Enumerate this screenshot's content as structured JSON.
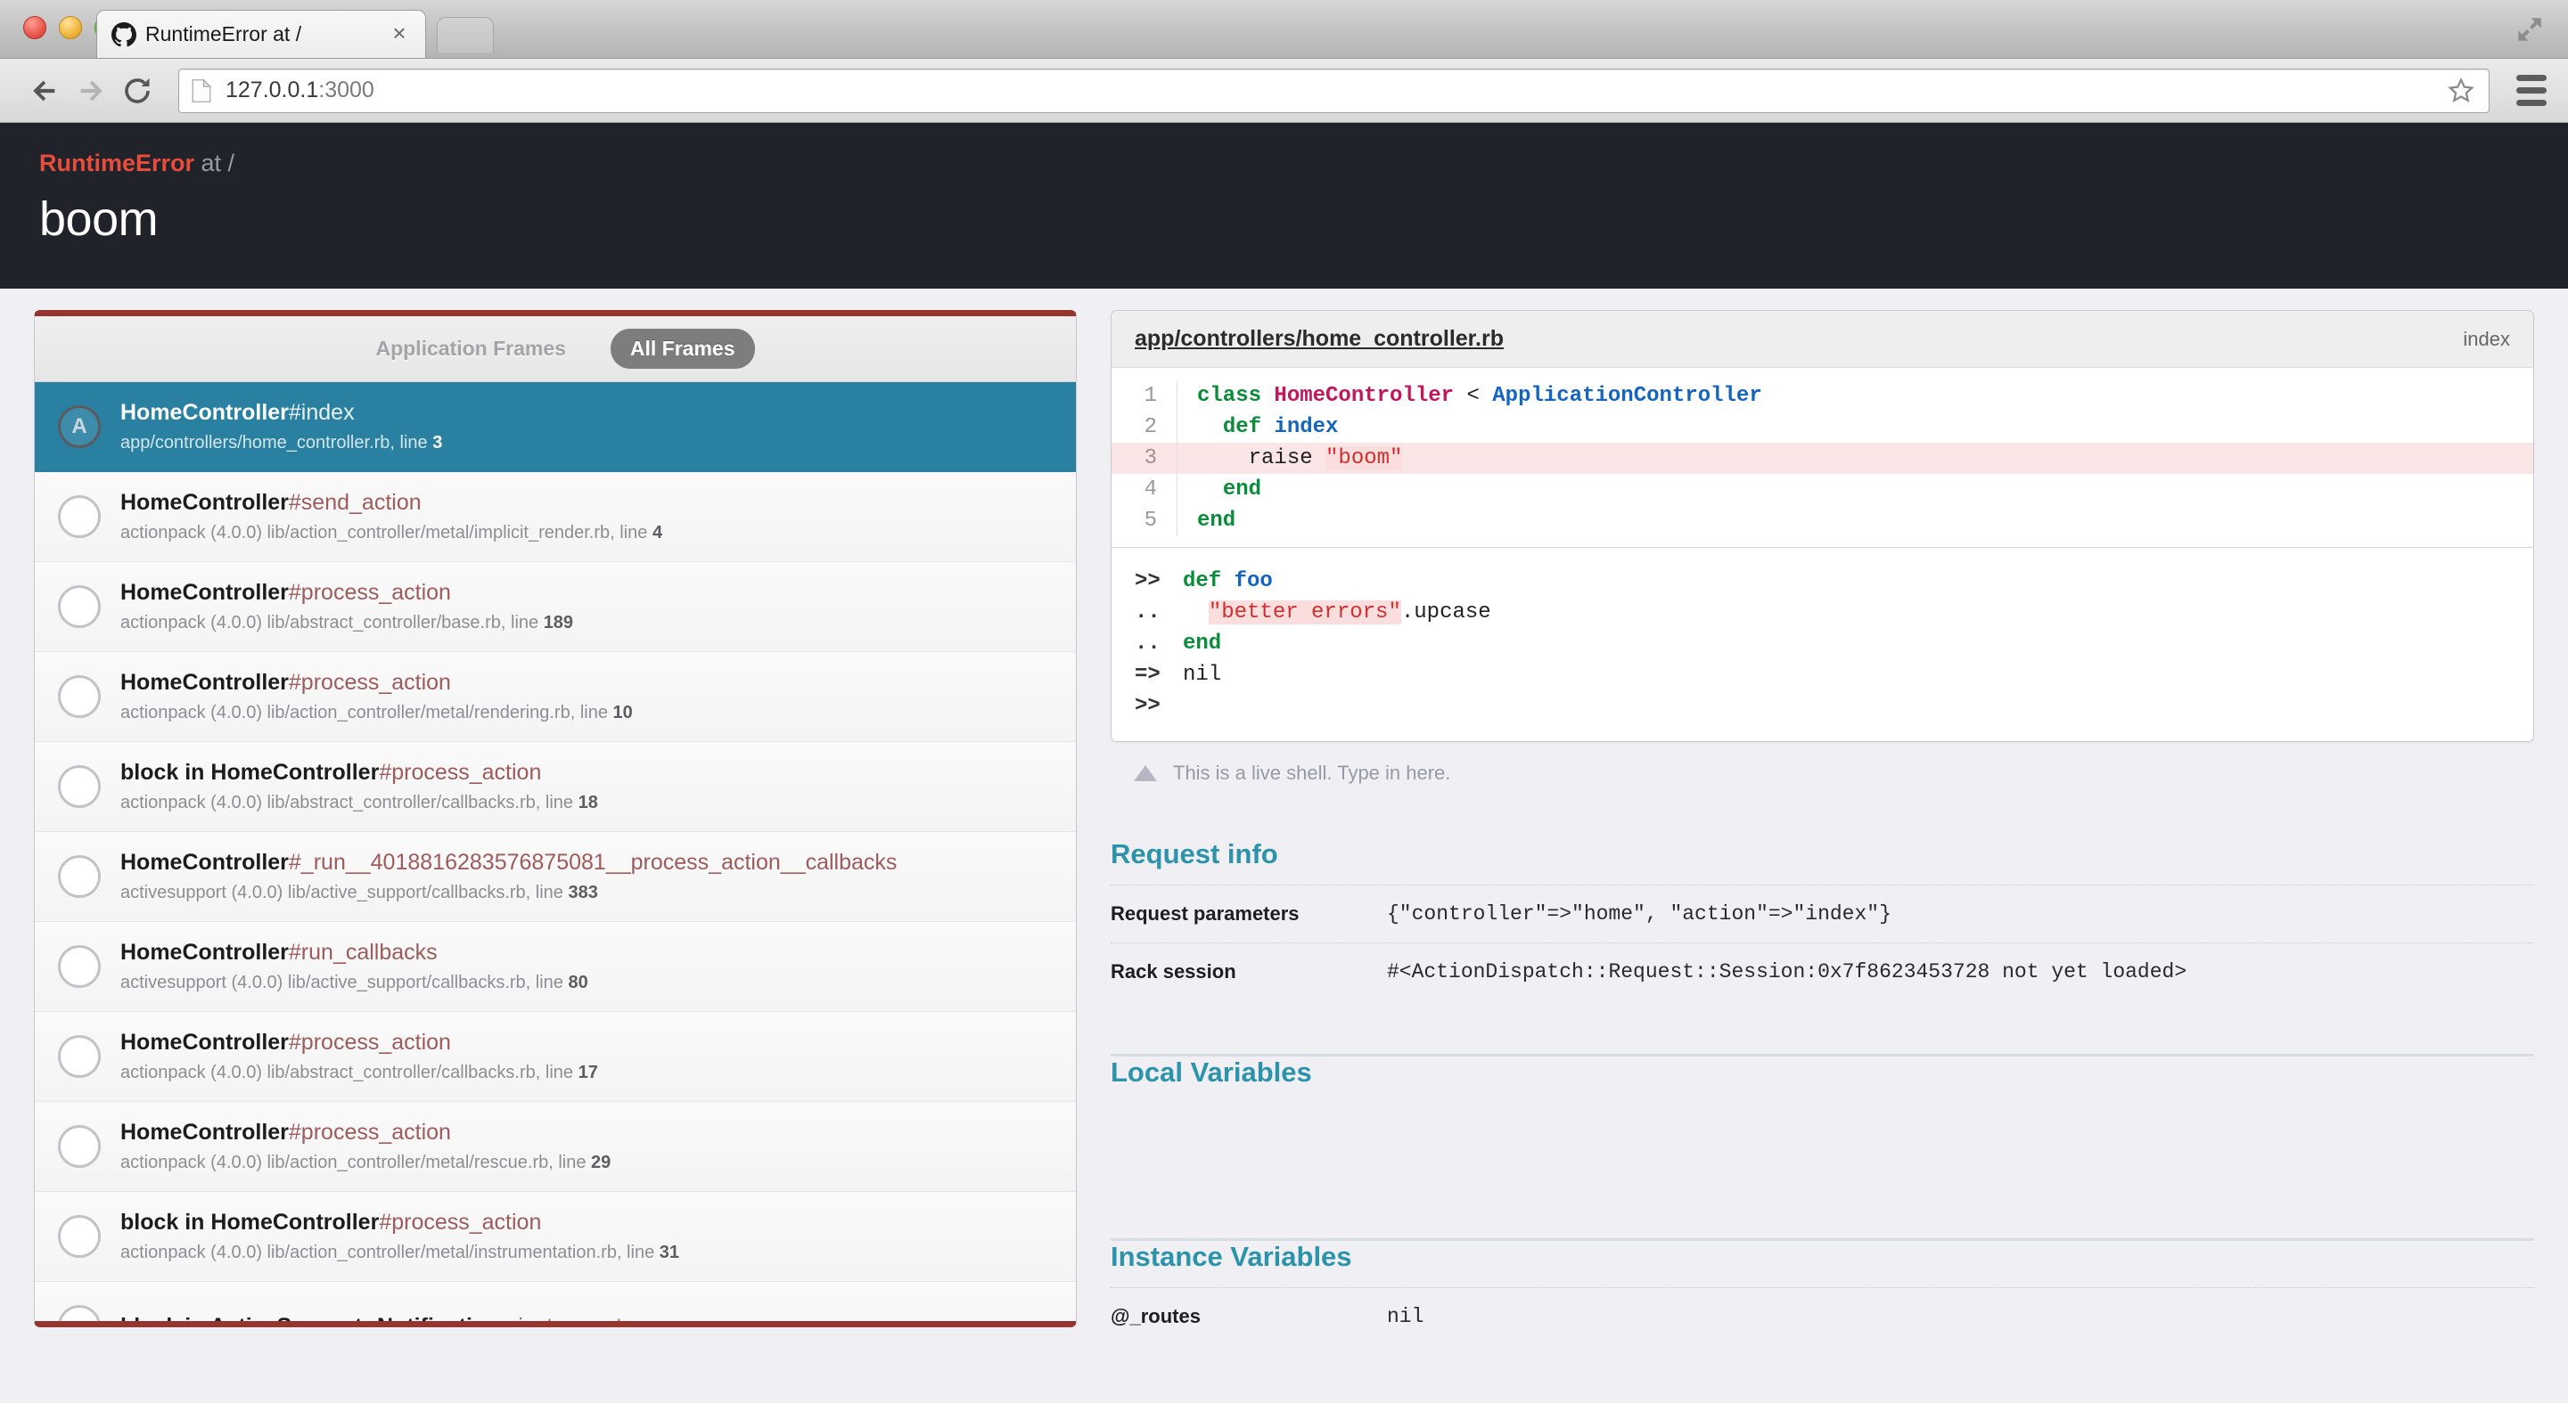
{
  "browser": {
    "tab_title": "RuntimeError at /",
    "tab_favicon": "github-octocat-icon",
    "close_icon": "close-icon",
    "new_tab_icon": "new-tab-button",
    "back_icon": "back-arrow-icon",
    "forward_icon": "forward-arrow-icon",
    "reload_icon": "reload-icon",
    "page_icon": "page-document-icon",
    "star_icon": "bookmark-star-icon",
    "menu_icon": "hamburger-menu-icon",
    "expand_icon": "fullscreen-expand-icon",
    "url_host": "127.0.0.1",
    "url_port": ":3000"
  },
  "error": {
    "exception": "RuntimeError",
    "at": " at /",
    "message": "boom"
  },
  "frames_panel": {
    "tabs": [
      {
        "label": "Application Frames",
        "active": false
      },
      {
        "label": "All Frames",
        "active": true
      }
    ],
    "frames": [
      {
        "badge": "A",
        "prefix": "",
        "cls": "HomeController",
        "meth": "#index",
        "file": "app/controllers/home_controller.rb, line ",
        "line": "3",
        "active": true
      },
      {
        "badge": "",
        "prefix": "",
        "cls": "HomeController",
        "meth": "#send_action",
        "file": "actionpack (4.0.0) lib/action_controller/metal/implicit_render.rb, line ",
        "line": "4",
        "active": false
      },
      {
        "badge": "",
        "prefix": "",
        "cls": "HomeController",
        "meth": "#process_action",
        "file": "actionpack (4.0.0) lib/abstract_controller/base.rb, line ",
        "line": "189",
        "active": false
      },
      {
        "badge": "",
        "prefix": "",
        "cls": "HomeController",
        "meth": "#process_action",
        "file": "actionpack (4.0.0) lib/action_controller/metal/rendering.rb, line ",
        "line": "10",
        "active": false
      },
      {
        "badge": "",
        "prefix": "block in ",
        "cls": "HomeController",
        "meth": "#process_action",
        "file": "actionpack (4.0.0) lib/abstract_controller/callbacks.rb, line ",
        "line": "18",
        "active": false
      },
      {
        "badge": "",
        "prefix": "",
        "cls": "HomeController",
        "meth": "#_run__4018816283576875081__process_action__callbacks",
        "file": "activesupport (4.0.0) lib/active_support/callbacks.rb, line ",
        "line": "383",
        "active": false
      },
      {
        "badge": "",
        "prefix": "",
        "cls": "HomeController",
        "meth": "#run_callbacks",
        "file": "activesupport (4.0.0) lib/active_support/callbacks.rb, line ",
        "line": "80",
        "active": false
      },
      {
        "badge": "",
        "prefix": "",
        "cls": "HomeController",
        "meth": "#process_action",
        "file": "actionpack (4.0.0) lib/abstract_controller/callbacks.rb, line ",
        "line": "17",
        "active": false
      },
      {
        "badge": "",
        "prefix": "",
        "cls": "HomeController",
        "meth": "#process_action",
        "file": "actionpack (4.0.0) lib/action_controller/metal/rescue.rb, line ",
        "line": "29",
        "active": false
      },
      {
        "badge": "",
        "prefix": "block in ",
        "cls": "HomeController",
        "meth": "#process_action",
        "file": "actionpack (4.0.0) lib/action_controller/metal/instrumentation.rb, line ",
        "line": "31",
        "active": false
      },
      {
        "badge": "",
        "prefix": "block in ",
        "cls": "ActiveSupport::Notifications",
        "meth": ".instrument",
        "file": "",
        "line": "",
        "active": false
      }
    ]
  },
  "source": {
    "file": "app/controllers/home_controller.rb",
    "method": "index",
    "lines": [
      {
        "n": "1",
        "highlight": false,
        "tokens": [
          {
            "t": "class ",
            "c": "k"
          },
          {
            "t": "HomeController",
            "c": "cn"
          },
          {
            "t": " < ",
            "c": ""
          },
          {
            "t": "ApplicationController",
            "c": "cn2"
          }
        ]
      },
      {
        "n": "2",
        "highlight": false,
        "tokens": [
          {
            "t": "  ",
            "c": ""
          },
          {
            "t": "def ",
            "c": "k"
          },
          {
            "t": "index",
            "c": "mn"
          }
        ]
      },
      {
        "n": "3",
        "highlight": true,
        "tokens": [
          {
            "t": "    raise ",
            "c": ""
          },
          {
            "t": "\"boom\"",
            "c": "sthl"
          }
        ]
      },
      {
        "n": "4",
        "highlight": false,
        "tokens": [
          {
            "t": "  ",
            "c": ""
          },
          {
            "t": "end",
            "c": "k"
          }
        ]
      },
      {
        "n": "5",
        "highlight": false,
        "tokens": [
          {
            "t": "end",
            "c": "k"
          }
        ]
      }
    ]
  },
  "repl": {
    "lines": [
      {
        "prompt": ">>",
        "tokens": [
          {
            "t": "def ",
            "c": "k"
          },
          {
            "t": "foo",
            "c": "mn"
          }
        ]
      },
      {
        "prompt": "..",
        "tokens": [
          {
            "t": "  ",
            "c": ""
          },
          {
            "t": "\"better errors\"",
            "c": "sthl"
          },
          {
            "t": ".upcase",
            "c": ""
          }
        ]
      },
      {
        "prompt": "..",
        "tokens": [
          {
            "t": "end",
            "c": "k"
          }
        ]
      },
      {
        "prompt": "=>",
        "tokens": [
          {
            "t": "nil",
            "c": ""
          }
        ]
      },
      {
        "prompt": ">>",
        "tokens": [
          {
            "t": "",
            "c": ""
          }
        ]
      }
    ],
    "hint": "This is a live shell. Type in here.",
    "hint_icon": "triangle-up-icon"
  },
  "sections": [
    {
      "title": "Request info",
      "rows": [
        {
          "key": "Request parameters",
          "value": "{\"controller\"=>\"home\", \"action\"=>\"index\"}"
        },
        {
          "key": "Rack session",
          "value": "#<ActionDispatch::Request::Session:0x7f8623453728 not yet loaded>"
        }
      ]
    },
    {
      "title": "Local Variables",
      "rows": []
    },
    {
      "title": "Instance Variables",
      "rows": [
        {
          "key": "@_routes",
          "value": "nil"
        }
      ]
    }
  ],
  "colors": {
    "header_bg": "#20232a",
    "exception_red": "#e74c3c",
    "panel_border_red": "#96352f",
    "active_frame_blue": "#2980a0",
    "section_teal": "#2c93ab",
    "highlight_pink": "#fae6e6"
  }
}
